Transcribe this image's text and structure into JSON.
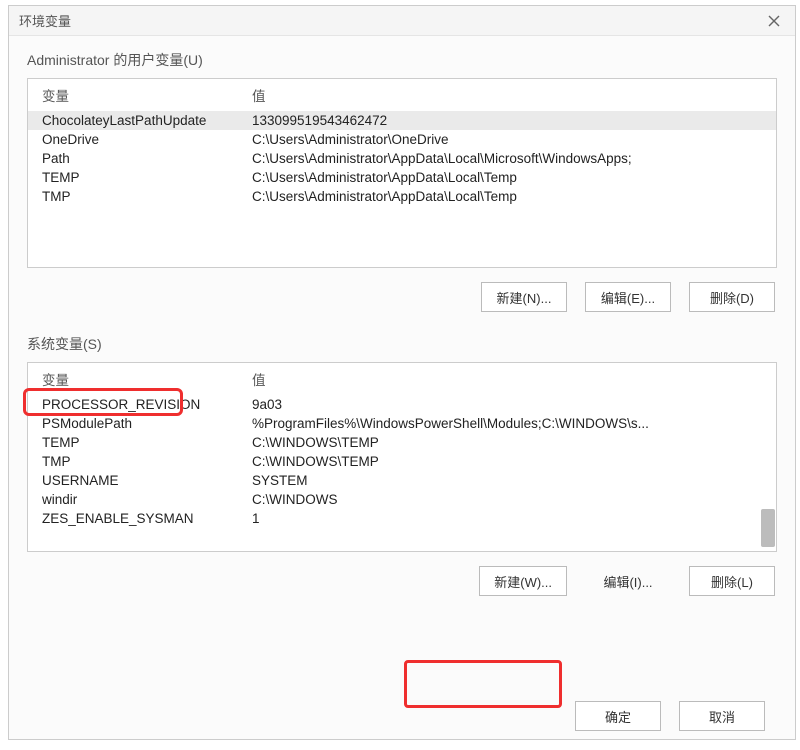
{
  "window": {
    "title": "环境变量"
  },
  "user_section": {
    "label": "Administrator 的用户变量(U)",
    "col_var": "变量",
    "col_val": "值",
    "rows": [
      {
        "name": "ChocolateyLastPathUpdate",
        "value": "133099519543462472"
      },
      {
        "name": "OneDrive",
        "value": "C:\\Users\\Administrator\\OneDrive"
      },
      {
        "name": "Path",
        "value": "C:\\Users\\Administrator\\AppData\\Local\\Microsoft\\WindowsApps;"
      },
      {
        "name": "TEMP",
        "value": "C:\\Users\\Administrator\\AppData\\Local\\Temp"
      },
      {
        "name": "TMP",
        "value": "C:\\Users\\Administrator\\AppData\\Local\\Temp"
      }
    ],
    "btn_new": "新建(N)...",
    "btn_edit": "编辑(E)...",
    "btn_del": "删除(D)"
  },
  "sys_section": {
    "label": "系统变量(S)",
    "col_var": "变量",
    "col_val": "值",
    "rows": [
      {
        "name": "PROCESSOR_REVISION",
        "value": "9a03"
      },
      {
        "name": "PSModulePath",
        "value": "%ProgramFiles%\\WindowsPowerShell\\Modules;C:\\WINDOWS\\s..."
      },
      {
        "name": "TEMP",
        "value": "C:\\WINDOWS\\TEMP"
      },
      {
        "name": "TMP",
        "value": "C:\\WINDOWS\\TEMP"
      },
      {
        "name": "USERNAME",
        "value": "SYSTEM"
      },
      {
        "name": "windir",
        "value": "C:\\WINDOWS"
      },
      {
        "name": "ZES_ENABLE_SYSMAN",
        "value": "1"
      }
    ],
    "btn_new": "新建(W)...",
    "btn_edit": "编辑(I)...",
    "btn_del": "删除(L)"
  },
  "footer": {
    "ok": "确定",
    "cancel": "取消"
  }
}
